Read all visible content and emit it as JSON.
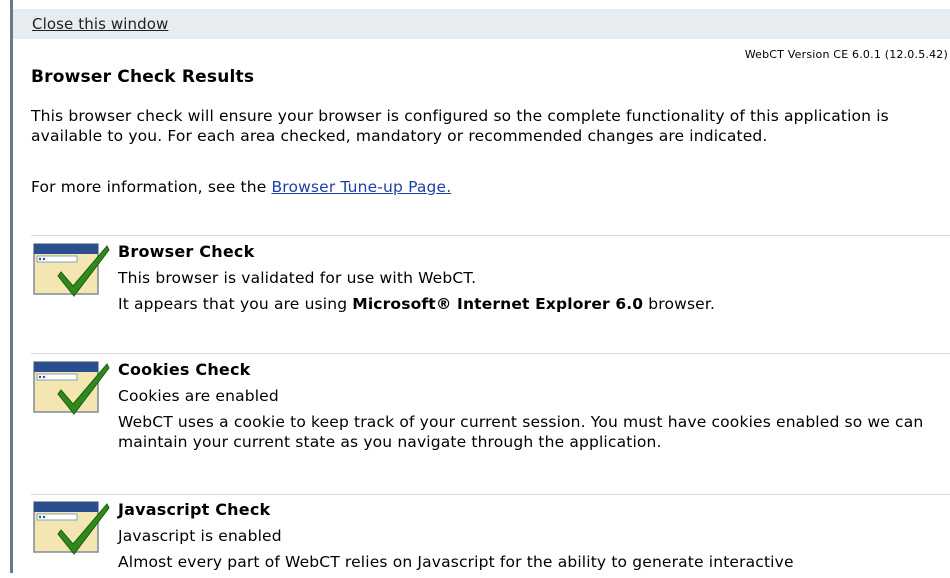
{
  "header": {
    "close_link": "Close this window",
    "version": "WebCT Version CE 6.0.1 (12.0.5.42)"
  },
  "page": {
    "title": "Browser Check Results",
    "intro": "This browser check will ensure your browser is configured so the complete functionality of this application is available to you. For each area checked, mandatory or recommended changes are indicated.",
    "more_info_prefix": "For more information, see the ",
    "more_info_link": "Browser Tune-up Page."
  },
  "checks": [
    {
      "title": "Browser Check",
      "status": "This browser is validated for use with WebCT.",
      "detail_prefix": "It appears that you are using ",
      "detail_bold": "Microsoft® Internet Explorer 6.0",
      "detail_suffix": " browser.",
      "icon": "window-checkmark-icon",
      "passed": true
    },
    {
      "title": "Cookies Check",
      "status": "Cookies are enabled",
      "detail": "WebCT uses a cookie to keep track of your current session. You must have cookies enabled so we can maintain your current state as you navigate through the application.",
      "icon": "window-checkmark-icon",
      "passed": true
    },
    {
      "title": "Javascript Check",
      "status": "Javascript is enabled",
      "detail": "Almost every part of WebCT relies on Javascript for the ability to generate interactive",
      "icon": "window-checkmark-icon",
      "passed": true
    }
  ],
  "colors": {
    "topbar": "#e7ecf0",
    "link": "#1f3ea8",
    "check_green": "#2f8a1c"
  }
}
